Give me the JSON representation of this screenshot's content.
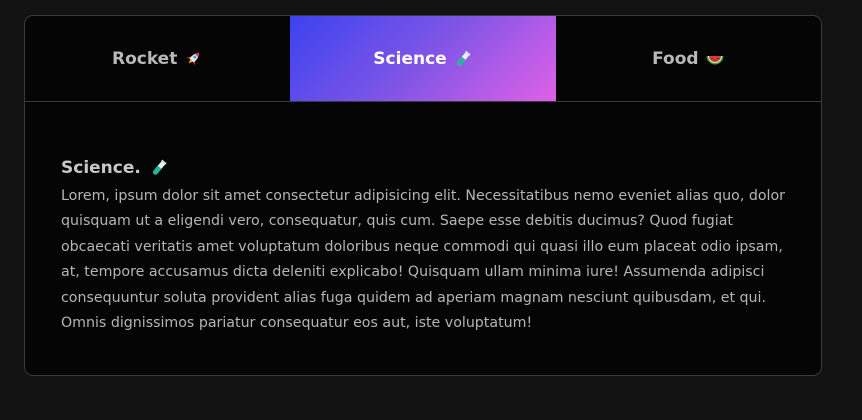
{
  "tabs": [
    {
      "label": "Rocket",
      "icon": "rocket-icon",
      "active": false
    },
    {
      "label": "Science",
      "icon": "test-tube-icon",
      "active": true
    },
    {
      "label": "Food",
      "icon": "watermelon-icon",
      "active": false
    }
  ],
  "panel": {
    "title": "Science.",
    "title_icon": "test-tube-icon",
    "body": "Lorem, ipsum dolor sit amet consectetur adipisicing elit. Necessitatibus nemo eveniet alias quo, dolor quisquam ut a eligendi vero, consequatur, quis cum. Saepe esse debitis ducimus? Quod fugiat obcaecati veritatis amet voluptatum doloribus neque commodi qui quasi illo eum placeat odio ipsam, at, tempore accusamus dicta deleniti explicabo! Quisquam ullam minima iure! Assumenda adipisci consequuntur soluta provident alias fuga quidem ad aperiam magnam nesciunt quibusdam, et qui. Omnis dignissimos pariatur consequatur eos aut, iste voluptatum!"
  },
  "colors": {
    "page_background": "#121212",
    "card_background": "#050505",
    "active_tab_gradient_start": "#3b43ee",
    "active_tab_gradient_end": "#e061e7"
  }
}
